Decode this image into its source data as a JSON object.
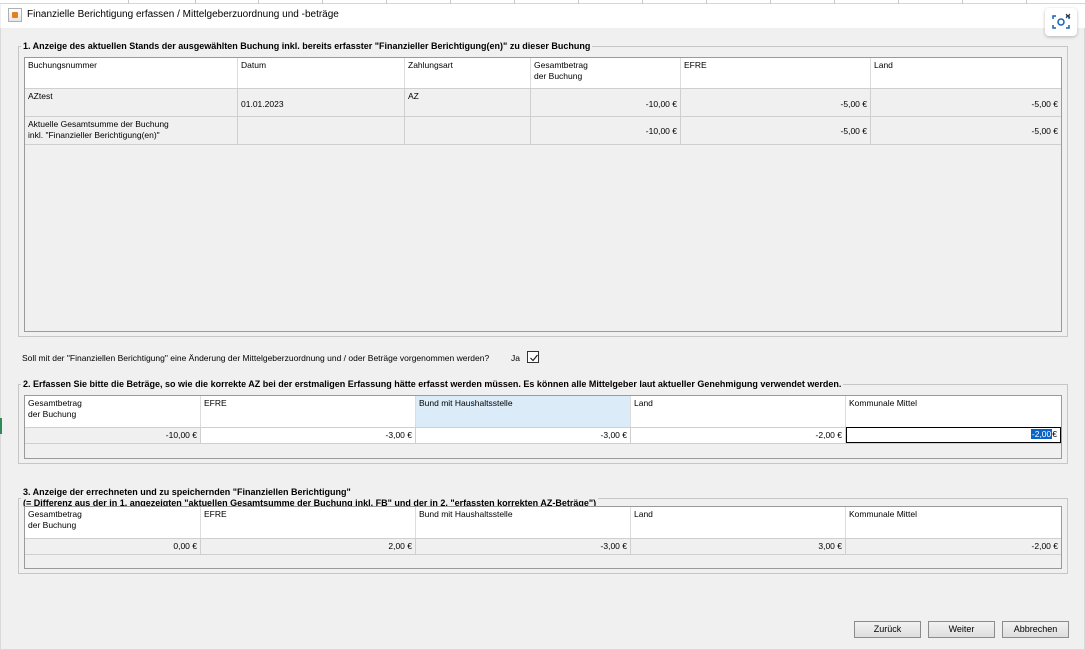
{
  "window": {
    "title": "Finanzielle Berichtigung erfassen / Mittelgeberzuordnung und -beträge"
  },
  "icons": {
    "app": "java-app-icon",
    "screenshot": "screen-capture-icon",
    "checkbox": "checkmark-icon"
  },
  "section1": {
    "legend": "1. Anzeige des aktuellen Stands der ausgewählten Buchung inkl. bereits erfasster \"Finanzieller Berichtigung(en)\" zu dieser Buchung",
    "headers": [
      "Buchungsnummer",
      "Datum",
      "Zahlungsart",
      "Gesamtbetrag\nder Buchung",
      "EFRE",
      "Land"
    ],
    "rows": [
      [
        "AZtest",
        "01.01.2023",
        "AZ",
        "-10,00 €",
        "-5,00 €",
        "-5,00 €"
      ],
      [
        "Aktuelle Gesamtsumme der Buchung\ninkl. \"Finanzieller Berichtigung(en)\"",
        "",
        "",
        "-10,00 €",
        "-5,00 €",
        "-5,00 €"
      ]
    ]
  },
  "question": {
    "text": "Soll mit der \"Finanziellen Berichtigung\" eine Änderung der Mittelgeberzuordnung und / oder Beträge vorgenommen werden?",
    "ja_label": "Ja",
    "checked": true
  },
  "section2": {
    "legend": "2. Erfassen Sie bitte die Beträge, so wie die korrekte AZ bei der erstmaligen Erfassung hätte erfasst werden müssen. Es können alle Mittelgeber laut aktueller Genehmigung verwendet werden.",
    "headers": [
      "Gesamtbetrag\nder Buchung",
      "EFRE",
      "Bund mit Haushaltsstelle",
      "Land",
      "Kommunale Mittel"
    ],
    "values": [
      "-10,00 €",
      "-3,00 €",
      "-3,00 €",
      "-2,00 €",
      "-2,00"
    ],
    "edit_suffix": "€"
  },
  "section3": {
    "legend_line1": "3. Anzeige der errechneten und zu speichernden \"Finanziellen Berichtigung\"",
    "legend_line2": "(= Differenz aus der in 1. angezeigten \"aktuellen Gesamtsumme der Buchung inkl. FB\" und der in 2. \"erfassten korrekten AZ-Beträge\")",
    "headers": [
      "Gesamtbetrag\nder Buchung",
      "EFRE",
      "Bund mit Haushaltsstelle",
      "Land",
      "Kommunale Mittel"
    ],
    "values": [
      "0,00 €",
      "2,00 €",
      "-3,00 €",
      "3,00 €",
      "-2,00 €"
    ]
  },
  "buttons": {
    "back": "Zurück",
    "next": "Weiter",
    "cancel": "Abbrechen"
  }
}
